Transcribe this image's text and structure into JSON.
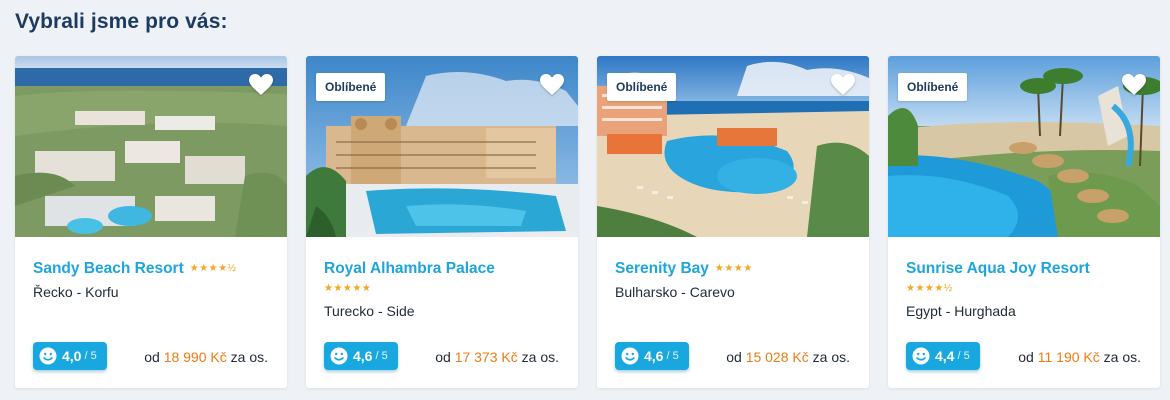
{
  "section": {
    "title": "Vybrali jsme pro vás:"
  },
  "cards": [
    {
      "badge": "",
      "name": "Sandy Beach Resort",
      "stars": "★★★★½",
      "location": "Řecko - Korfu",
      "rating": "4,0",
      "rating_max": "/ 5",
      "price_prefix": "od",
      "price": "18 990 Kč",
      "price_suffix": "za os."
    },
    {
      "badge": "Oblíbené",
      "name": "Royal Alhambra Palace",
      "stars": "★★★★★",
      "location": "Turecko - Side",
      "rating": "4,6",
      "rating_max": "/ 5",
      "price_prefix": "od",
      "price": "17 373 Kč",
      "price_suffix": "za os."
    },
    {
      "badge": "Oblíbené",
      "name": "Serenity Bay",
      "stars": "★★★★",
      "location": "Bulharsko - Carevo",
      "rating": "4,6",
      "rating_max": "/ 5",
      "price_prefix": "od",
      "price": "15 028 Kč",
      "price_suffix": "za os."
    },
    {
      "badge": "Oblíbené",
      "name": "Sunrise Aqua Joy Resort",
      "stars": "★★★★½",
      "location": "Egypt - Hurghada",
      "rating": "4,4",
      "rating_max": "/ 5",
      "price_prefix": "od",
      "price": "11 190 Kč",
      "price_suffix": "za os."
    }
  ],
  "icons": {
    "favorite": "heart-icon",
    "rating": "smiley-face-icon"
  },
  "colors": {
    "title": "#1d3a5f",
    "link": "#1ea5dc",
    "price": "#f07b13",
    "rating_bg": "#18a7de",
    "stars": "#f5a623"
  }
}
